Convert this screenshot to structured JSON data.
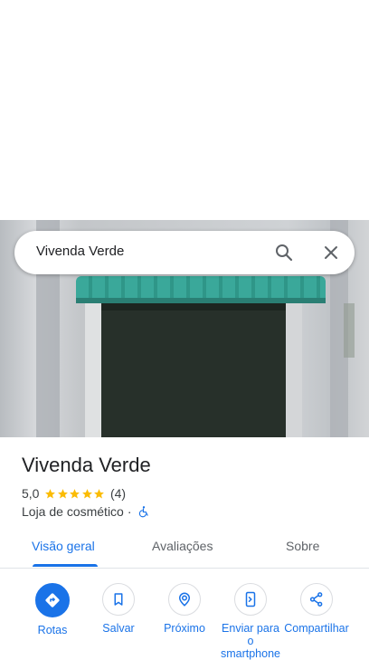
{
  "search": {
    "query": "Vivenda Verde"
  },
  "place": {
    "name": "Vivenda Verde",
    "rating": "5,0",
    "stars": 5,
    "review_count": "(4)",
    "category": "Loja de cosmético",
    "separator": "·"
  },
  "tabs": [
    {
      "label": "Visão geral"
    },
    {
      "label": "Avaliações"
    },
    {
      "label": "Sobre"
    }
  ],
  "actions": [
    {
      "label": "Rotas",
      "icon": "directions-icon"
    },
    {
      "label": "Salvar",
      "icon": "bookmark-icon"
    },
    {
      "label": "Próximo",
      "icon": "nearby-icon"
    },
    {
      "label": "Enviar para o smartphone",
      "icon": "send-to-phone-icon"
    },
    {
      "label": "Compartilhar",
      "icon": "share-icon"
    }
  ],
  "colors": {
    "accent": "#1a73e8",
    "star": "#fbbc04"
  }
}
